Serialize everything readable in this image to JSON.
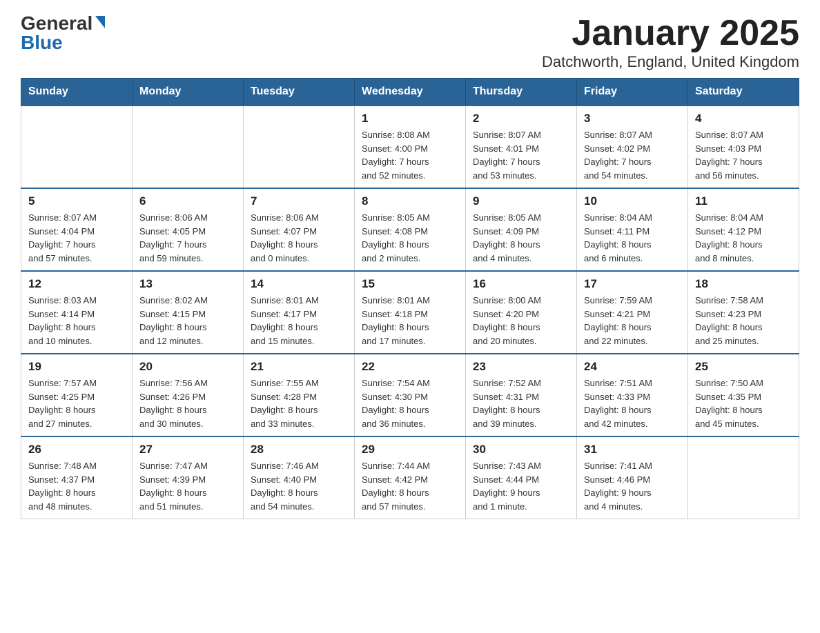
{
  "logo": {
    "general": "General",
    "blue": "Blue"
  },
  "title": "January 2025",
  "subtitle": "Datchworth, England, United Kingdom",
  "headers": [
    "Sunday",
    "Monday",
    "Tuesday",
    "Wednesday",
    "Thursday",
    "Friday",
    "Saturday"
  ],
  "weeks": [
    [
      {
        "day": "",
        "info": ""
      },
      {
        "day": "",
        "info": ""
      },
      {
        "day": "",
        "info": ""
      },
      {
        "day": "1",
        "info": "Sunrise: 8:08 AM\nSunset: 4:00 PM\nDaylight: 7 hours\nand 52 minutes."
      },
      {
        "day": "2",
        "info": "Sunrise: 8:07 AM\nSunset: 4:01 PM\nDaylight: 7 hours\nand 53 minutes."
      },
      {
        "day": "3",
        "info": "Sunrise: 8:07 AM\nSunset: 4:02 PM\nDaylight: 7 hours\nand 54 minutes."
      },
      {
        "day": "4",
        "info": "Sunrise: 8:07 AM\nSunset: 4:03 PM\nDaylight: 7 hours\nand 56 minutes."
      }
    ],
    [
      {
        "day": "5",
        "info": "Sunrise: 8:07 AM\nSunset: 4:04 PM\nDaylight: 7 hours\nand 57 minutes."
      },
      {
        "day": "6",
        "info": "Sunrise: 8:06 AM\nSunset: 4:05 PM\nDaylight: 7 hours\nand 59 minutes."
      },
      {
        "day": "7",
        "info": "Sunrise: 8:06 AM\nSunset: 4:07 PM\nDaylight: 8 hours\nand 0 minutes."
      },
      {
        "day": "8",
        "info": "Sunrise: 8:05 AM\nSunset: 4:08 PM\nDaylight: 8 hours\nand 2 minutes."
      },
      {
        "day": "9",
        "info": "Sunrise: 8:05 AM\nSunset: 4:09 PM\nDaylight: 8 hours\nand 4 minutes."
      },
      {
        "day": "10",
        "info": "Sunrise: 8:04 AM\nSunset: 4:11 PM\nDaylight: 8 hours\nand 6 minutes."
      },
      {
        "day": "11",
        "info": "Sunrise: 8:04 AM\nSunset: 4:12 PM\nDaylight: 8 hours\nand 8 minutes."
      }
    ],
    [
      {
        "day": "12",
        "info": "Sunrise: 8:03 AM\nSunset: 4:14 PM\nDaylight: 8 hours\nand 10 minutes."
      },
      {
        "day": "13",
        "info": "Sunrise: 8:02 AM\nSunset: 4:15 PM\nDaylight: 8 hours\nand 12 minutes."
      },
      {
        "day": "14",
        "info": "Sunrise: 8:01 AM\nSunset: 4:17 PM\nDaylight: 8 hours\nand 15 minutes."
      },
      {
        "day": "15",
        "info": "Sunrise: 8:01 AM\nSunset: 4:18 PM\nDaylight: 8 hours\nand 17 minutes."
      },
      {
        "day": "16",
        "info": "Sunrise: 8:00 AM\nSunset: 4:20 PM\nDaylight: 8 hours\nand 20 minutes."
      },
      {
        "day": "17",
        "info": "Sunrise: 7:59 AM\nSunset: 4:21 PM\nDaylight: 8 hours\nand 22 minutes."
      },
      {
        "day": "18",
        "info": "Sunrise: 7:58 AM\nSunset: 4:23 PM\nDaylight: 8 hours\nand 25 minutes."
      }
    ],
    [
      {
        "day": "19",
        "info": "Sunrise: 7:57 AM\nSunset: 4:25 PM\nDaylight: 8 hours\nand 27 minutes."
      },
      {
        "day": "20",
        "info": "Sunrise: 7:56 AM\nSunset: 4:26 PM\nDaylight: 8 hours\nand 30 minutes."
      },
      {
        "day": "21",
        "info": "Sunrise: 7:55 AM\nSunset: 4:28 PM\nDaylight: 8 hours\nand 33 minutes."
      },
      {
        "day": "22",
        "info": "Sunrise: 7:54 AM\nSunset: 4:30 PM\nDaylight: 8 hours\nand 36 minutes."
      },
      {
        "day": "23",
        "info": "Sunrise: 7:52 AM\nSunset: 4:31 PM\nDaylight: 8 hours\nand 39 minutes."
      },
      {
        "day": "24",
        "info": "Sunrise: 7:51 AM\nSunset: 4:33 PM\nDaylight: 8 hours\nand 42 minutes."
      },
      {
        "day": "25",
        "info": "Sunrise: 7:50 AM\nSunset: 4:35 PM\nDaylight: 8 hours\nand 45 minutes."
      }
    ],
    [
      {
        "day": "26",
        "info": "Sunrise: 7:48 AM\nSunset: 4:37 PM\nDaylight: 8 hours\nand 48 minutes."
      },
      {
        "day": "27",
        "info": "Sunrise: 7:47 AM\nSunset: 4:39 PM\nDaylight: 8 hours\nand 51 minutes."
      },
      {
        "day": "28",
        "info": "Sunrise: 7:46 AM\nSunset: 4:40 PM\nDaylight: 8 hours\nand 54 minutes."
      },
      {
        "day": "29",
        "info": "Sunrise: 7:44 AM\nSunset: 4:42 PM\nDaylight: 8 hours\nand 57 minutes."
      },
      {
        "day": "30",
        "info": "Sunrise: 7:43 AM\nSunset: 4:44 PM\nDaylight: 9 hours\nand 1 minute."
      },
      {
        "day": "31",
        "info": "Sunrise: 7:41 AM\nSunset: 4:46 PM\nDaylight: 9 hours\nand 4 minutes."
      },
      {
        "day": "",
        "info": ""
      }
    ]
  ]
}
